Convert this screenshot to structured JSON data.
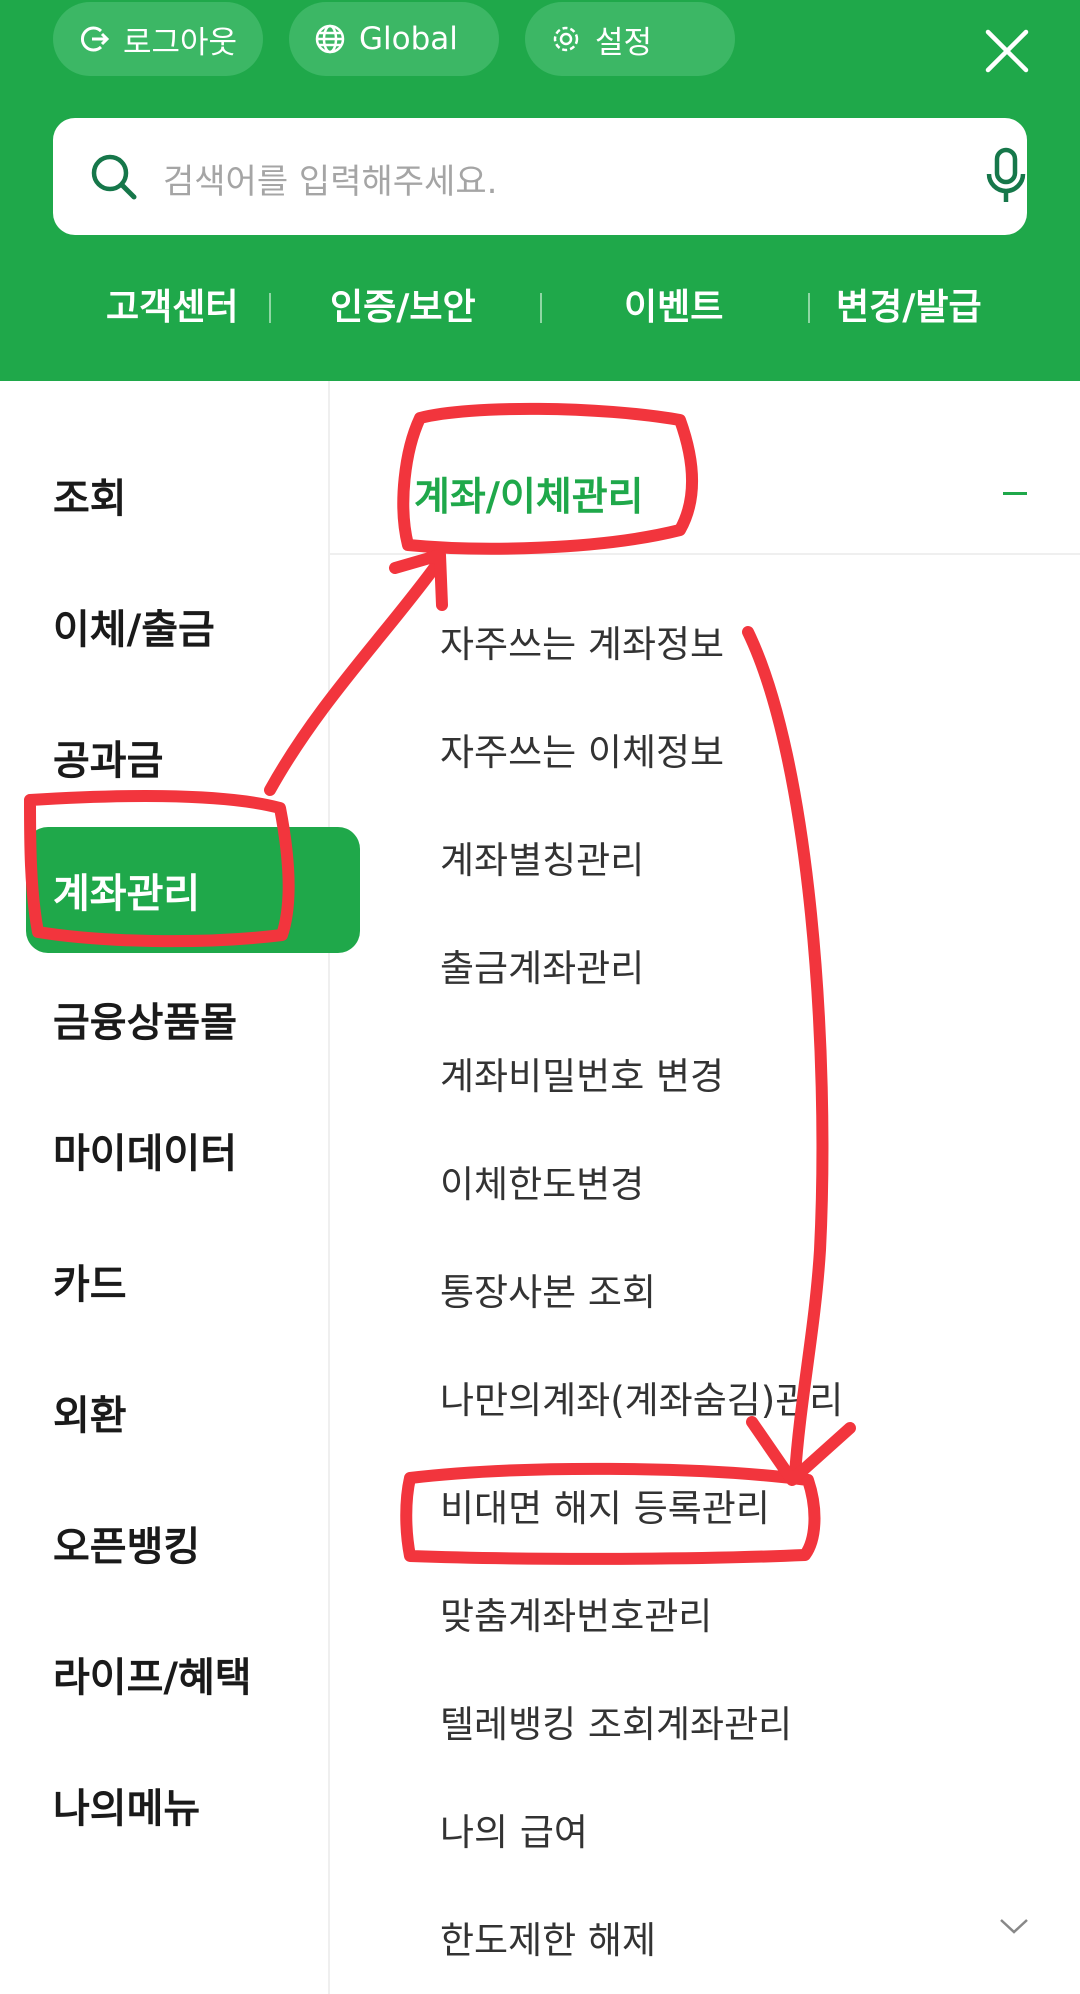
{
  "header": {
    "logout_label": "로그아웃",
    "global_label": "Global",
    "settings_label": "설정",
    "search_placeholder": "검색어를 입력해주세요.",
    "quick_links": [
      "고객센터",
      "인증/보안",
      "이벤트",
      "변경/발급"
    ]
  },
  "sidebar": {
    "items": [
      "조회",
      "이체/출금",
      "공과금",
      "계좌관리",
      "금융상품몰",
      "마이데이터",
      "카드",
      "외환",
      "오픈뱅킹",
      "라이프/혜택",
      "나의메뉴"
    ],
    "active": "계좌관리"
  },
  "content": {
    "section_title": "계좌/이체관리",
    "items": [
      "자주쓰는 계좌정보",
      "자주쓰는 이체정보",
      "계좌별칭관리",
      "출금계좌관리",
      "계좌비밀번호 변경",
      "이체한도변경",
      "통장사본 조회",
      "나만의계좌(계좌숨김)관리",
      "비대면 해지 등록관리",
      "맞춤계좌번호관리",
      "텔레뱅킹 조회계좌관리",
      "나의 급여",
      "한도제한 해제"
    ]
  },
  "colors": {
    "brand_green": "#1fa84a",
    "annotation_red": "#f2353d"
  },
  "icons": [
    "logout-icon",
    "globe-icon",
    "gear-icon",
    "close-icon",
    "search-icon",
    "mic-icon",
    "chevron-down-icon"
  ]
}
